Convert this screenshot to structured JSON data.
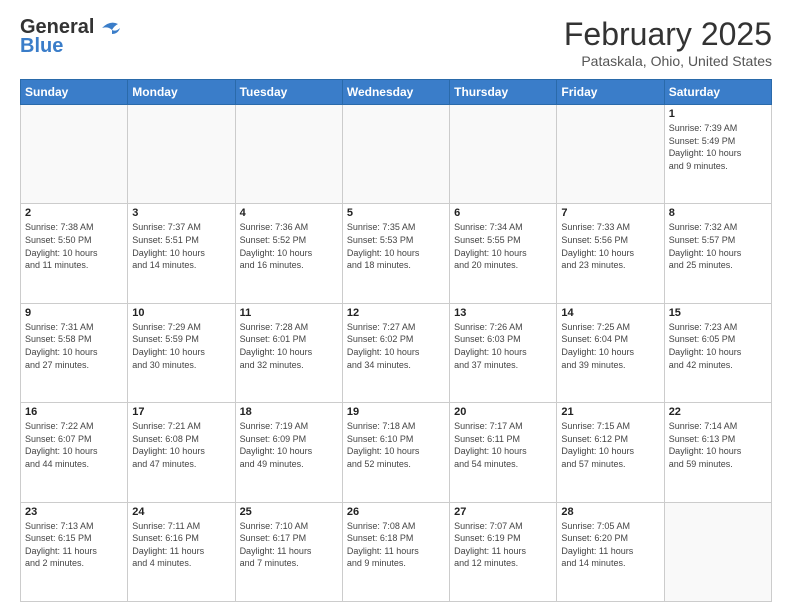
{
  "header": {
    "logo_general": "General",
    "logo_blue": "Blue",
    "month_year": "February 2025",
    "location": "Pataskala, Ohio, United States"
  },
  "weekdays": [
    "Sunday",
    "Monday",
    "Tuesday",
    "Wednesday",
    "Thursday",
    "Friday",
    "Saturday"
  ],
  "weeks": [
    [
      {
        "day": "",
        "info": ""
      },
      {
        "day": "",
        "info": ""
      },
      {
        "day": "",
        "info": ""
      },
      {
        "day": "",
        "info": ""
      },
      {
        "day": "",
        "info": ""
      },
      {
        "day": "",
        "info": ""
      },
      {
        "day": "1",
        "info": "Sunrise: 7:39 AM\nSunset: 5:49 PM\nDaylight: 10 hours\nand 9 minutes."
      }
    ],
    [
      {
        "day": "2",
        "info": "Sunrise: 7:38 AM\nSunset: 5:50 PM\nDaylight: 10 hours\nand 11 minutes."
      },
      {
        "day": "3",
        "info": "Sunrise: 7:37 AM\nSunset: 5:51 PM\nDaylight: 10 hours\nand 14 minutes."
      },
      {
        "day": "4",
        "info": "Sunrise: 7:36 AM\nSunset: 5:52 PM\nDaylight: 10 hours\nand 16 minutes."
      },
      {
        "day": "5",
        "info": "Sunrise: 7:35 AM\nSunset: 5:53 PM\nDaylight: 10 hours\nand 18 minutes."
      },
      {
        "day": "6",
        "info": "Sunrise: 7:34 AM\nSunset: 5:55 PM\nDaylight: 10 hours\nand 20 minutes."
      },
      {
        "day": "7",
        "info": "Sunrise: 7:33 AM\nSunset: 5:56 PM\nDaylight: 10 hours\nand 23 minutes."
      },
      {
        "day": "8",
        "info": "Sunrise: 7:32 AM\nSunset: 5:57 PM\nDaylight: 10 hours\nand 25 minutes."
      }
    ],
    [
      {
        "day": "9",
        "info": "Sunrise: 7:31 AM\nSunset: 5:58 PM\nDaylight: 10 hours\nand 27 minutes."
      },
      {
        "day": "10",
        "info": "Sunrise: 7:29 AM\nSunset: 5:59 PM\nDaylight: 10 hours\nand 30 minutes."
      },
      {
        "day": "11",
        "info": "Sunrise: 7:28 AM\nSunset: 6:01 PM\nDaylight: 10 hours\nand 32 minutes."
      },
      {
        "day": "12",
        "info": "Sunrise: 7:27 AM\nSunset: 6:02 PM\nDaylight: 10 hours\nand 34 minutes."
      },
      {
        "day": "13",
        "info": "Sunrise: 7:26 AM\nSunset: 6:03 PM\nDaylight: 10 hours\nand 37 minutes."
      },
      {
        "day": "14",
        "info": "Sunrise: 7:25 AM\nSunset: 6:04 PM\nDaylight: 10 hours\nand 39 minutes."
      },
      {
        "day": "15",
        "info": "Sunrise: 7:23 AM\nSunset: 6:05 PM\nDaylight: 10 hours\nand 42 minutes."
      }
    ],
    [
      {
        "day": "16",
        "info": "Sunrise: 7:22 AM\nSunset: 6:07 PM\nDaylight: 10 hours\nand 44 minutes."
      },
      {
        "day": "17",
        "info": "Sunrise: 7:21 AM\nSunset: 6:08 PM\nDaylight: 10 hours\nand 47 minutes."
      },
      {
        "day": "18",
        "info": "Sunrise: 7:19 AM\nSunset: 6:09 PM\nDaylight: 10 hours\nand 49 minutes."
      },
      {
        "day": "19",
        "info": "Sunrise: 7:18 AM\nSunset: 6:10 PM\nDaylight: 10 hours\nand 52 minutes."
      },
      {
        "day": "20",
        "info": "Sunrise: 7:17 AM\nSunset: 6:11 PM\nDaylight: 10 hours\nand 54 minutes."
      },
      {
        "day": "21",
        "info": "Sunrise: 7:15 AM\nSunset: 6:12 PM\nDaylight: 10 hours\nand 57 minutes."
      },
      {
        "day": "22",
        "info": "Sunrise: 7:14 AM\nSunset: 6:13 PM\nDaylight: 10 hours\nand 59 minutes."
      }
    ],
    [
      {
        "day": "23",
        "info": "Sunrise: 7:13 AM\nSunset: 6:15 PM\nDaylight: 11 hours\nand 2 minutes."
      },
      {
        "day": "24",
        "info": "Sunrise: 7:11 AM\nSunset: 6:16 PM\nDaylight: 11 hours\nand 4 minutes."
      },
      {
        "day": "25",
        "info": "Sunrise: 7:10 AM\nSunset: 6:17 PM\nDaylight: 11 hours\nand 7 minutes."
      },
      {
        "day": "26",
        "info": "Sunrise: 7:08 AM\nSunset: 6:18 PM\nDaylight: 11 hours\nand 9 minutes."
      },
      {
        "day": "27",
        "info": "Sunrise: 7:07 AM\nSunset: 6:19 PM\nDaylight: 11 hours\nand 12 minutes."
      },
      {
        "day": "28",
        "info": "Sunrise: 7:05 AM\nSunset: 6:20 PM\nDaylight: 11 hours\nand 14 minutes."
      },
      {
        "day": "",
        "info": ""
      }
    ]
  ]
}
